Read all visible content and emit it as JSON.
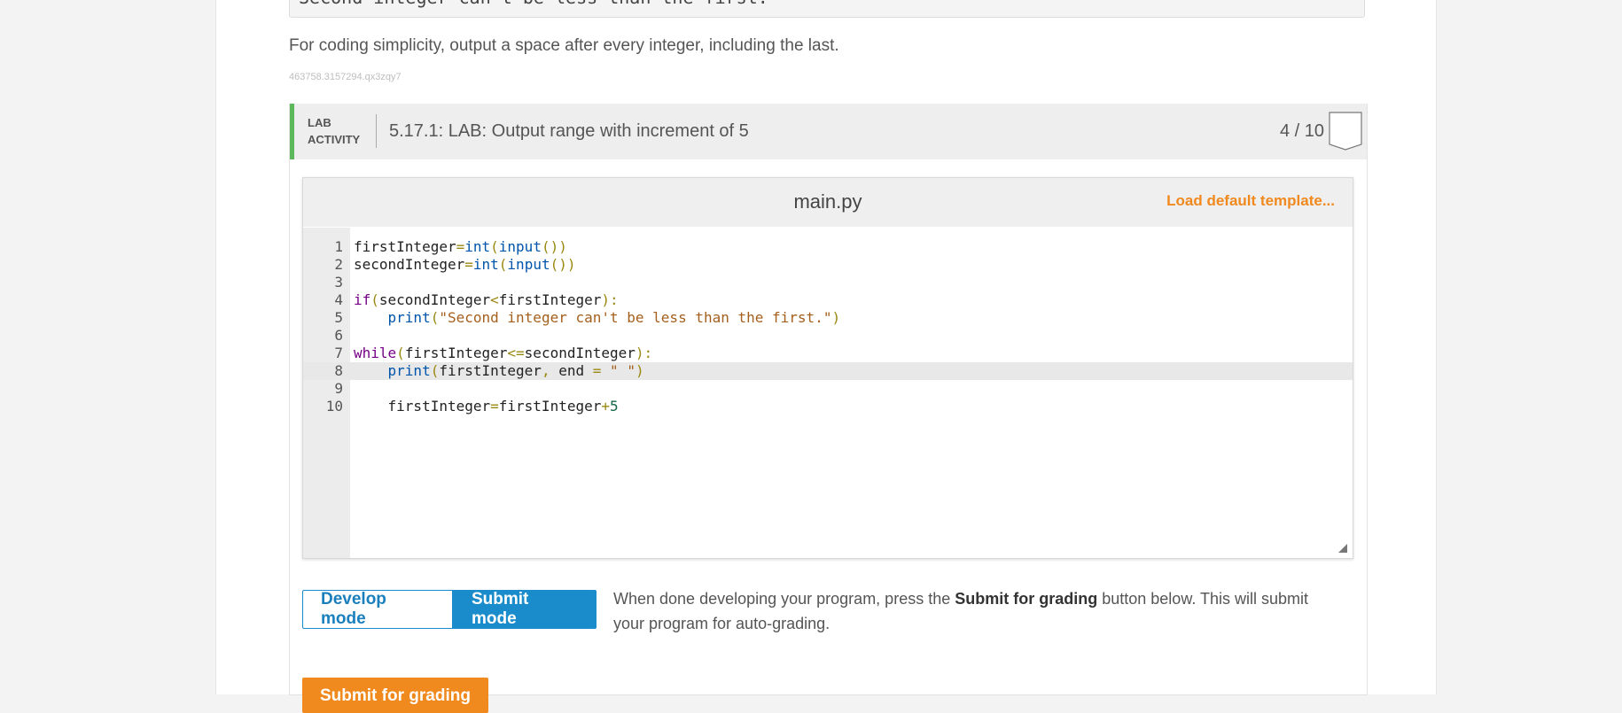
{
  "previous_output": "Second integer can't be less than the first.",
  "instructions": "For coding simplicity, output a space after every integer, including the last.",
  "code_id": "463758.3157294.qx3zqy7",
  "lab": {
    "tag_line1": "LAB",
    "tag_line2": "ACTIVITY",
    "title": "5.17.1: LAB: Output range with increment of 5",
    "score": "4 / 10",
    "accent_color": "#5cb85c"
  },
  "editor": {
    "file_name": "main.py",
    "load_default": "Load default template...",
    "active_line": 8,
    "lines": [
      {
        "n": "1",
        "text": "firstInteger=int(input())"
      },
      {
        "n": "2",
        "text": "secondInteger=int(input())"
      },
      {
        "n": "3",
        "text": ""
      },
      {
        "n": "4",
        "text": "if(secondInteger<firstInteger):"
      },
      {
        "n": "5",
        "text": "    print(\"Second integer can't be less than the first.\")"
      },
      {
        "n": "6",
        "text": ""
      },
      {
        "n": "7",
        "text": "while(firstInteger<=secondInteger):"
      },
      {
        "n": "8",
        "text": "    print(firstInteger, end = \" \")"
      },
      {
        "n": "9",
        "text": ""
      },
      {
        "n": "10",
        "text": "    firstInteger=firstInteger+5"
      }
    ]
  },
  "modes": {
    "develop": "Develop mode",
    "submit": "Submit mode",
    "help_before": "When done developing your program, press the ",
    "help_bold": "Submit for grading",
    "help_after": " button below. This will submit your program for auto-grading."
  },
  "submit_button": "Submit for grading"
}
